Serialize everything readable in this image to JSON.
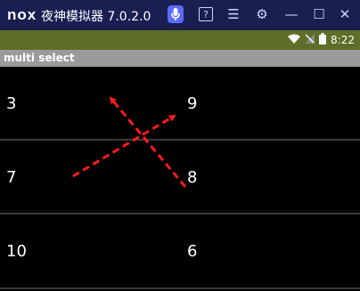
{
  "window": {
    "logo_text": "nox",
    "title": "夜神模拟器 7.0.2.0"
  },
  "titlebar_icons": [
    "mic-icon",
    "help-icon",
    "menu-icon",
    "gear-icon",
    "minimize-icon",
    "maximize-icon",
    "close-icon"
  ],
  "titlebar_glyphs": {
    "help": "?",
    "menu": "☰",
    "gear": "⚙",
    "minimize": "—",
    "maximize": "☐",
    "close": "✕"
  },
  "statusbar": {
    "time": "8:22"
  },
  "appbar": {
    "title": "multi select"
  },
  "grid": {
    "rows": [
      {
        "left": "3",
        "right": "9"
      },
      {
        "left": "7",
        "right": "8"
      },
      {
        "left": "10",
        "right": "6"
      }
    ]
  },
  "colors": {
    "titlebar": "#1a1f52",
    "statusbar": "#5e6e28",
    "appbar": "#9b9b9b",
    "arrow": "#ff1a1a"
  }
}
